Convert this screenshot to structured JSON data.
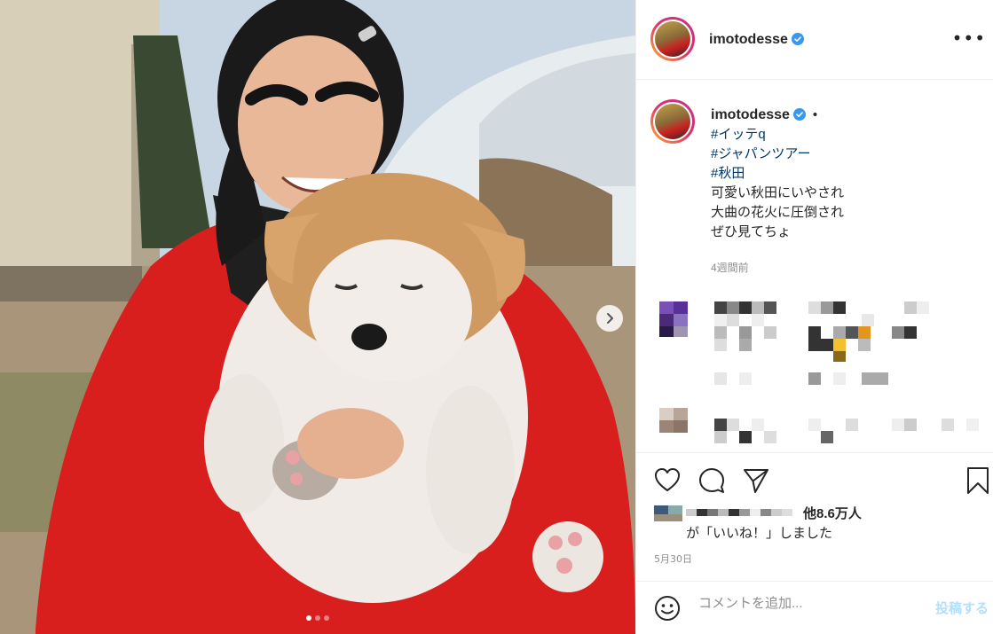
{
  "post": {
    "username": "imotodesse",
    "verified": true,
    "separator": "•",
    "caption": {
      "hashtags": [
        "#イッテq",
        "#ジャパンツアー",
        "#秋田"
      ],
      "lines": [
        "可愛い秋田にいやされ",
        "大曲の花火に圧倒され",
        "ぜひ見てちょ"
      ]
    },
    "relative_time": "4週間前",
    "likes": {
      "count": "他8.6万人",
      "text": "が「いいね！」しました"
    },
    "date": "5月30日"
  },
  "carousel": {
    "total_slides": 3,
    "active_slide": 1
  },
  "comment_box": {
    "placeholder": "コメントを追加...",
    "post_label": "投稿する"
  },
  "icons": {
    "more": "more-options-icon",
    "like": "heart-icon",
    "comment": "comment-icon",
    "share": "share-icon",
    "save": "bookmark-icon",
    "emoji": "emoji-icon",
    "next": "chevron-right-icon",
    "verified": "verified-badge-icon"
  },
  "colors": {
    "hashtag": "#00376b",
    "verified": "#3897f0",
    "post_button_disabled": "#b2dffc",
    "muted": "#8e8e8e",
    "jacket_red": "#d91e1e"
  }
}
